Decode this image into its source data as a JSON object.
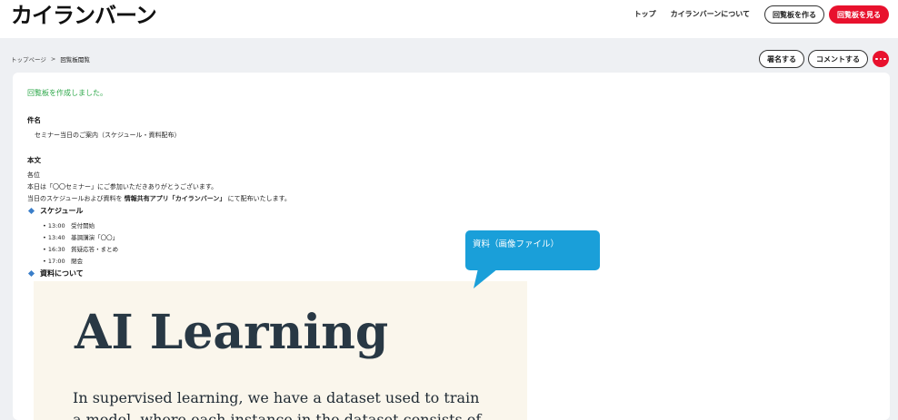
{
  "header": {
    "logo": "カイランバーン",
    "nav": {
      "top": "トップ",
      "about": "カイランバーンについて",
      "create": "回覧板を作る",
      "view": "回覧板を見る"
    }
  },
  "breadcrumb": {
    "home": "トップページ",
    "separator": ">",
    "current": "回覧板閲覧"
  },
  "actions": {
    "sign": "署名する",
    "comment": "コメントする",
    "more_icon": "more-horizontal-icon"
  },
  "card": {
    "success_message": "回覧板を作成しました。",
    "subject_label": "件名",
    "subject": "セミナー当日のご案内（スケジュール・資料配布）",
    "body_label": "本文",
    "body_lines": {
      "l1": "各位",
      "l2": "本日は「〇〇セミナー」にご参加いただきありがとうございます。",
      "l3_pre": "当日のスケジュールおよび資料を ",
      "l3_bold": "情報共有アプリ「カイランバーン」",
      "l3_post": " にて配布いたします。"
    },
    "schedule_heading": "スケジュール",
    "schedule": [
      "• 13:00　受付開始",
      "• 13:40　基調講演「〇〇」",
      "• 16:30　質疑応答・まとめ",
      "• 17:00　閉会"
    ],
    "materials_heading": "資料について"
  },
  "doc_image": {
    "title": "AI Learning",
    "line1": "In supervised learning, we have a dataset used to train",
    "line2": "a model, where each instance in the dataset consists of"
  },
  "callout": {
    "text": "資料（画像ファイル）"
  },
  "colors": {
    "brand_red": "#e8112d",
    "success_green": "#2ea84a",
    "callout_blue": "#1a9fd9",
    "bullet_blue": "#3a7ec9",
    "page_bg": "#eef0f3"
  }
}
